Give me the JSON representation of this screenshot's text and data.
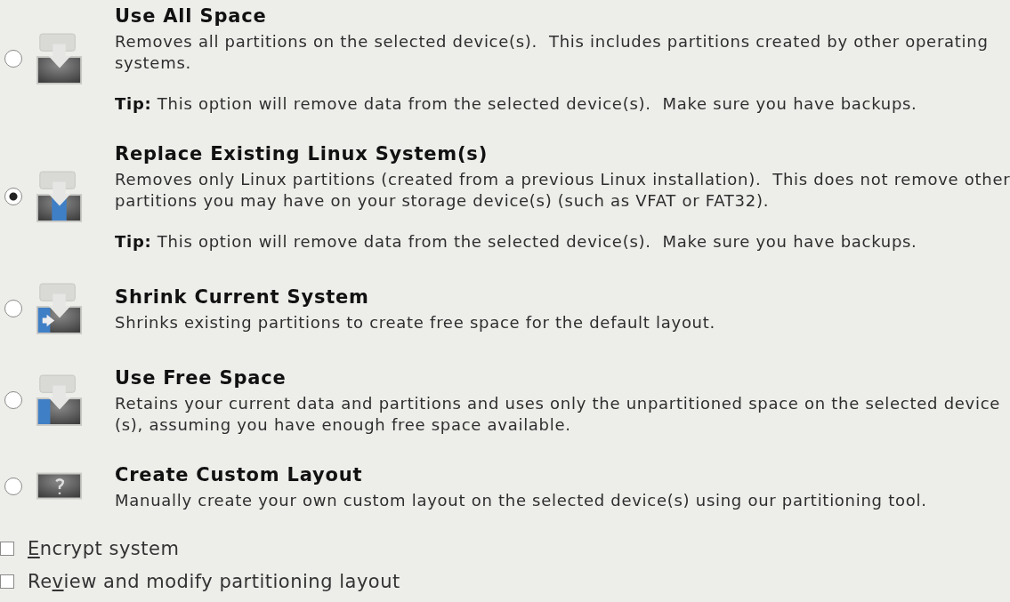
{
  "options": [
    {
      "kind": "use-all",
      "selected": false,
      "title": "Use All Space",
      "description": "Removes all partitions on the selected device(s).  This includes partitions created by other operating systems.",
      "tip_label": "Tip:",
      "tip": "This option will remove data from the selected device(s).  Make sure you have backups."
    },
    {
      "kind": "replace-linux",
      "selected": true,
      "title": "Replace Existing Linux System(s)",
      "description": "Removes only Linux partitions (created from a previous Linux installation).  This does not remove other partitions you may have on your storage device(s) (such as VFAT or FAT32).",
      "tip_label": "Tip:",
      "tip": "This option will remove data from the selected device(s).  Make sure you have backups."
    },
    {
      "kind": "shrink",
      "selected": false,
      "title": "Shrink Current System",
      "description": "Shrinks existing partitions to create free space for the default layout."
    },
    {
      "kind": "free-space",
      "selected": false,
      "title": "Use Free Space",
      "description": "Retains your current data and partitions and uses only the unpartitioned space on the selected device (s), assuming you have enough free space available."
    },
    {
      "kind": "custom",
      "selected": false,
      "title": "Create Custom Layout",
      "description": "Manually create your own custom layout on the selected device(s) using our partitioning tool."
    }
  ],
  "checkboxes": [
    {
      "mnemonic": "E",
      "label_after": "ncrypt system",
      "checked": false
    },
    {
      "label_before": "Re",
      "mnemonic": "v",
      "label_after": "iew and modify partitioning layout",
      "checked": false
    }
  ]
}
